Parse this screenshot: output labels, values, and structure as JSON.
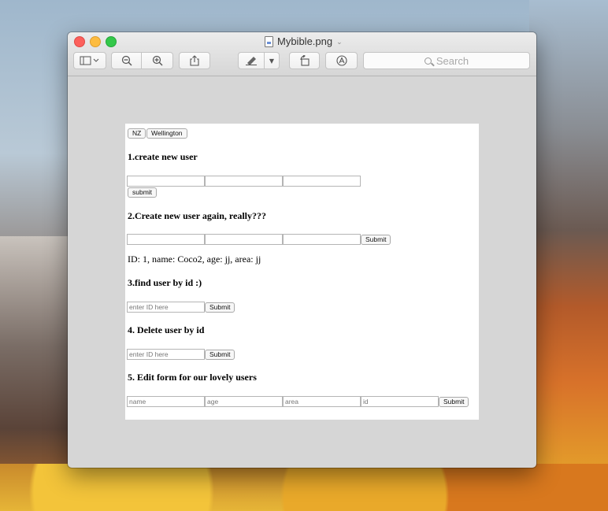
{
  "window": {
    "title": "Mybible.png",
    "search_placeholder": "Search"
  },
  "toolbar": {
    "sidebar_icon": "sidebar-icon",
    "zoom_out_icon": "zoom-out-icon",
    "zoom_in_icon": "zoom-in-icon",
    "share_icon": "share-icon",
    "markup_icon": "markup-pen-icon",
    "rotate_icon": "rotate-icon",
    "annotate_icon": "annotate-icon"
  },
  "content": {
    "top_buttons": [
      "NZ",
      "Wellington"
    ],
    "section1": {
      "heading": "1.create new user",
      "submit": "submit"
    },
    "section2": {
      "heading": "2.Create new user again, really???",
      "submit": "Submit",
      "result": "ID: 1, name: Coco2, age: jj, area: jj"
    },
    "section3": {
      "heading": "3.find user by id :)",
      "placeholder": "enter ID here",
      "submit": "Submit"
    },
    "section4": {
      "heading": "4. Delete user by id",
      "placeholder": "enter ID here",
      "submit": "Submit"
    },
    "section5": {
      "heading": "5. Edit form for our lovely users",
      "placeholders": [
        "name",
        "age",
        "area",
        "id"
      ],
      "submit": "Submit"
    }
  },
  "colors": {
    "close": "#fc605c",
    "minimize": "#fdbc40",
    "maximize": "#34c84a",
    "window_bg": "#d6d6d6"
  }
}
